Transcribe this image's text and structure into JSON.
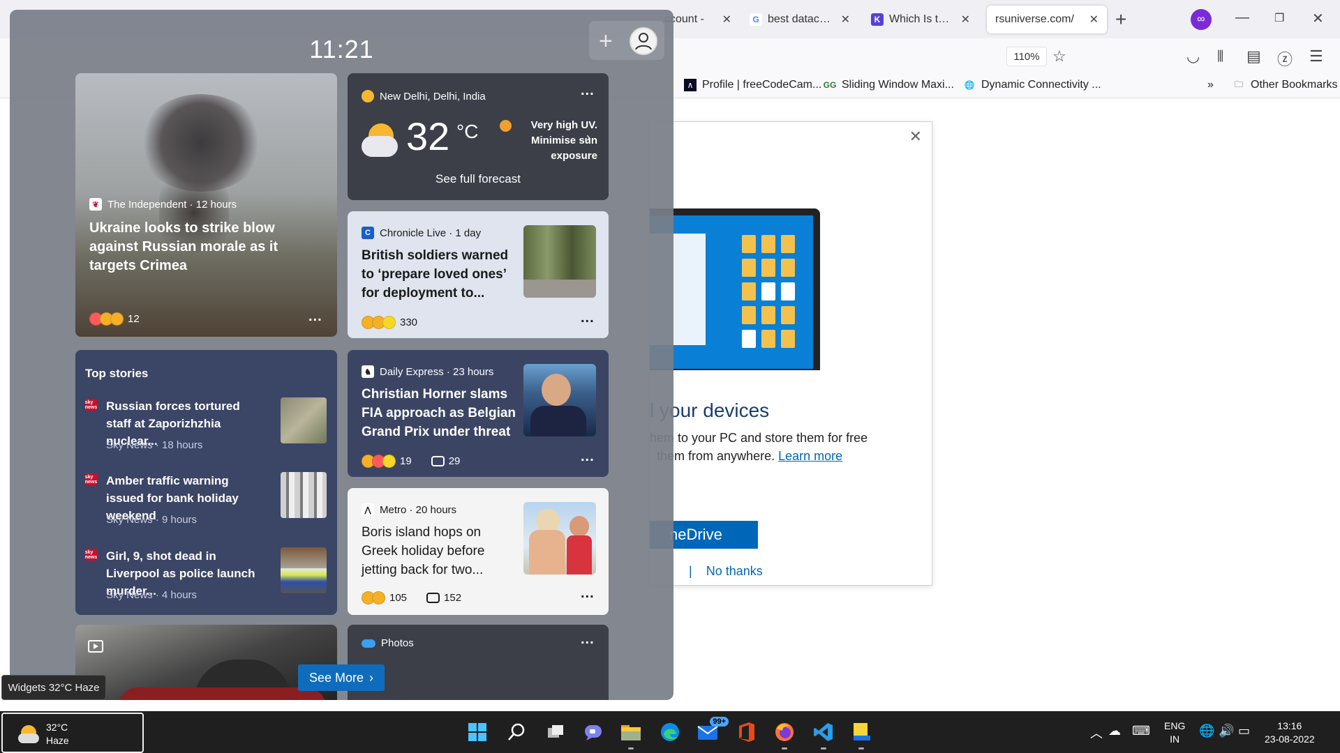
{
  "browser": {
    "tabs": [
      {
        "label": "ccount - ",
        "favicon": "generic-icon"
      },
      {
        "label": "best datacente",
        "favicon": "google-icon"
      },
      {
        "label": "Which Is the Be",
        "favicon": "k-icon"
      },
      {
        "label": "rsuniverse.com/",
        "favicon": "none",
        "active": true
      }
    ],
    "zoom": "110%",
    "bookmarks": [
      {
        "label": "Profile | freeCodeCam..."
      },
      {
        "label": "Sliding Window Maxi..."
      },
      {
        "label": "Dynamic Connectivity ..."
      }
    ],
    "other_bookmarks": "Other Bookmarks"
  },
  "onedrive": {
    "title": "l your devices",
    "line1": "hem to your PC and store them for free",
    "line2": "them from anywhere.",
    "learn_more": "Learn more",
    "button": "neDrive",
    "no_thanks": "No thanks",
    "separator": "|"
  },
  "widgets": {
    "clock": "11:21",
    "cards": {
      "ukraine": {
        "source": "The Independent · 12 hours",
        "headline": "Ukraine looks to strike blow against Russian morale as it targets Crimea",
        "reactions": "12",
        "more": "..."
      },
      "weather": {
        "location": "New Delhi, Delhi, India",
        "temp": "32",
        "unit": "°C",
        "uv": "Very high UV. Minimise sun exposure",
        "forecast": "See full forecast",
        "more": "..."
      },
      "soldiers": {
        "source": "Chronicle Live · 1 day",
        "headline": "British soldiers warned to ‘prepare loved ones’ for deployment to...",
        "reactions": "330",
        "more": "..."
      },
      "horner": {
        "source": "Daily Express · 23 hours",
        "headline": "Christian Horner slams FIA approach as Belgian Grand Prix under threat",
        "reactions": "19",
        "comments": "29",
        "more": "..."
      },
      "boris": {
        "source": "Metro · 20 hours",
        "headline": "Boris island hops on Greek holiday before jetting back for two...",
        "reactions": "105",
        "comments": "152",
        "more": "..."
      },
      "photos": {
        "label": "Photos",
        "more": "..."
      }
    },
    "top_stories": {
      "title": "Top stories",
      "items": [
        {
          "headline": "Russian forces tortured staff at Zaporizhzhia nuclear...",
          "meta": "Sky News · 18 hours"
        },
        {
          "headline": "Amber traffic warning issued for bank holiday weekend",
          "meta": "Sky News · 9 hours"
        },
        {
          "headline": "Girl, 9, shot dead in Liverpool as police launch murder...",
          "meta": "Sky News · 4 hours"
        }
      ],
      "sky_logo": "sky news"
    },
    "see_more": "See More",
    "tooltip": "Widgets 32°C Haze"
  },
  "taskbar": {
    "weather_temp": "32°C",
    "weather_cond": "Haze",
    "mail_badge": "99+",
    "lang_line1": "ENG",
    "lang_line2": "IN",
    "time": "13:16",
    "date": "23-08-2022"
  },
  "colors": {
    "accent": "#0f6cbd",
    "panel": "#787e88",
    "taskbar": "#1f1f1f"
  }
}
